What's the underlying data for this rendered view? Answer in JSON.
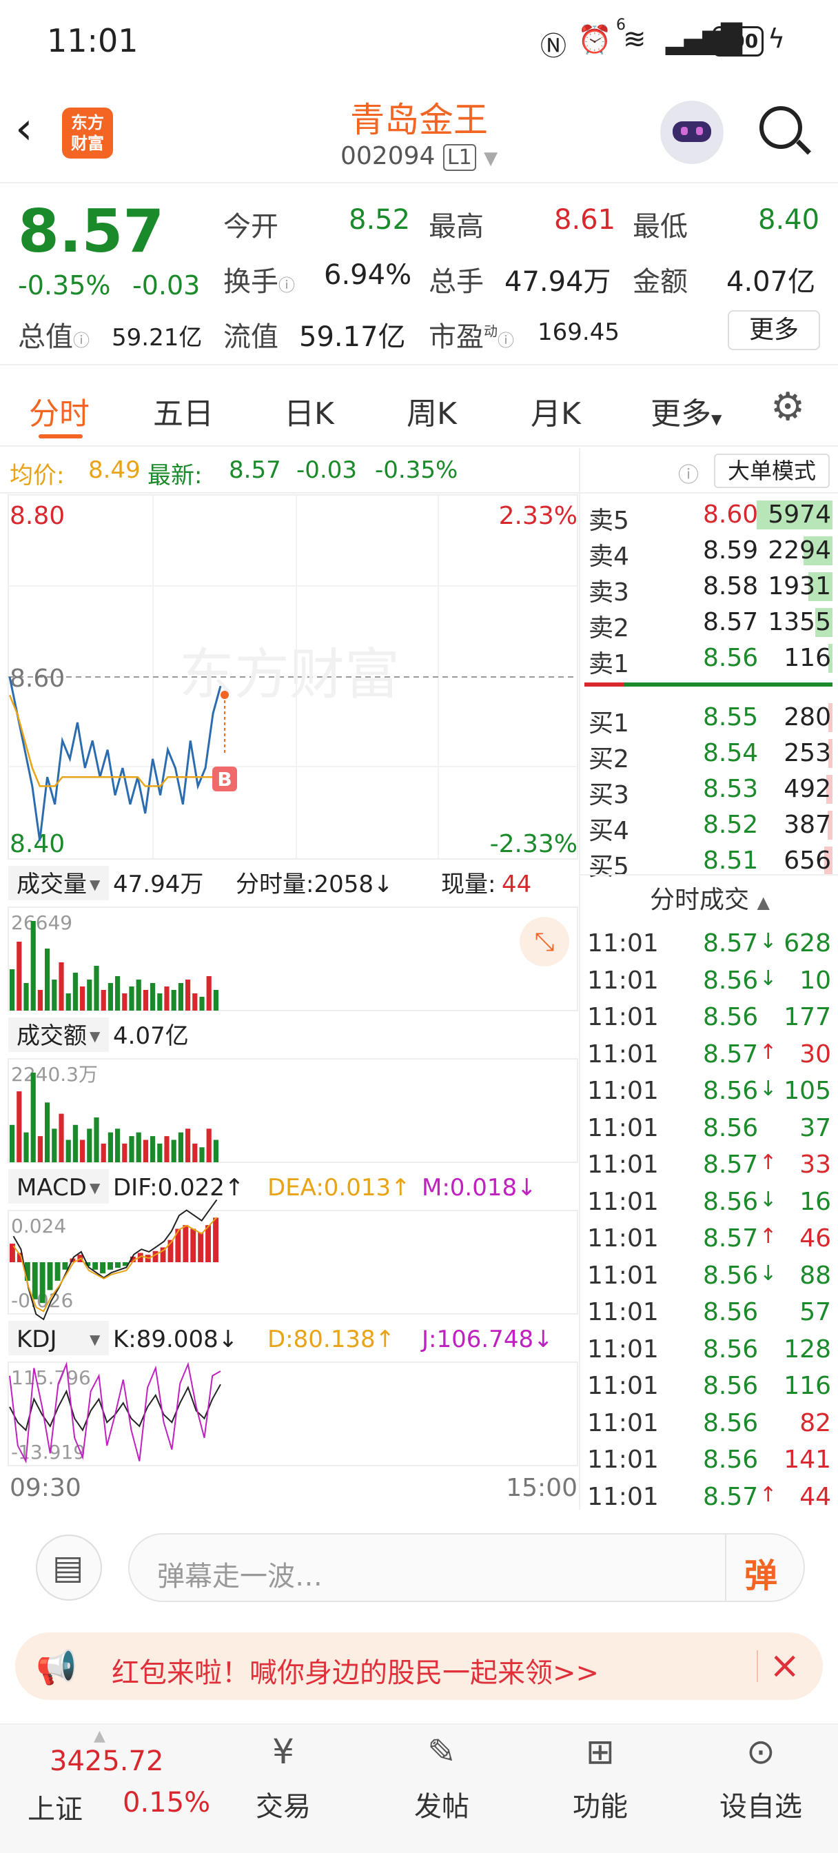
{
  "status_bar": {
    "time": "11:01",
    "battery": "100",
    "signal_label": "6"
  },
  "header": {
    "app_logo_line1": "东方",
    "app_logo_line2": "财富",
    "stock_name": "青岛金王",
    "stock_code": "002094",
    "level_badge": "L1"
  },
  "quote": {
    "price": "8.57",
    "change_pct": "-0.35%",
    "change_abs": "-0.03",
    "open_label": "今开",
    "open_value": "8.52",
    "high_label": "最高",
    "high_value": "8.61",
    "low_label": "最低",
    "low_value": "8.40",
    "turnover_label": "换手",
    "turnover_value": "6.94%",
    "volume_label": "总手",
    "volume_value": "47.94万",
    "amount_label": "金额",
    "amount_value": "4.07亿",
    "mktcap_label": "总值",
    "mktcap_value": "59.21亿",
    "float_label": "流值",
    "float_value": "59.17亿",
    "pe_label": "市盈",
    "pe_sup": "动",
    "pe_value": "169.45",
    "more_button": "更多"
  },
  "tabs": [
    {
      "label": "分时"
    },
    {
      "label": "五日"
    },
    {
      "label": "日K"
    },
    {
      "label": "周K"
    },
    {
      "label": "月K"
    },
    {
      "label": "更多"
    }
  ],
  "chart_header": {
    "avg_label": "均价:",
    "avg_value": "8.49",
    "latest_label": "最新:",
    "latest_value": "8.57",
    "latest_change": "-0.03",
    "latest_pct": "-0.35%",
    "big_order_mode": "大单模式"
  },
  "chart_data": [
    {
      "type": "line",
      "name_label": "分时",
      "y_high": "8.80",
      "y_mid": "8.60",
      "y_low": "8.40",
      "pct_high": "2.33%",
      "pct_low": "-2.33%",
      "watermark": "东方财富",
      "marker": "B",
      "series": [
        {
          "name": "价格",
          "color": "#2b6cb0",
          "values": [
            8.6,
            8.56,
            8.52,
            8.48,
            8.42,
            8.49,
            8.46,
            8.53,
            8.51,
            8.55,
            8.5,
            8.53,
            8.49,
            8.52,
            8.47,
            8.5,
            8.46,
            8.49,
            8.45,
            8.51,
            8.47,
            8.52,
            8.5,
            8.46,
            8.53,
            8.48,
            8.5,
            8.56,
            8.59
          ]
        },
        {
          "name": "均价",
          "color": "#e8a317",
          "values": [
            8.58,
            8.56,
            8.53,
            8.5,
            8.48,
            8.48,
            8.48,
            8.49,
            8.49,
            8.49,
            8.49,
            8.49,
            8.49,
            8.49,
            8.49,
            8.49,
            8.49,
            8.49,
            8.48,
            8.48,
            8.48,
            8.49,
            8.49,
            8.49,
            8.49,
            8.49,
            8.49,
            8.49,
            8.49
          ]
        }
      ],
      "ylim": [
        8.4,
        8.8
      ]
    },
    {
      "type": "bar",
      "name_label": "成交量",
      "total": "47.94万",
      "minute_vol_label": "分时量:2058↓",
      "current_vol_label": "现量:",
      "current_vol_value": "44",
      "y_max": "26649",
      "values": [
        12,
        20,
        8,
        26,
        6,
        18,
        9,
        14,
        5,
        11,
        7,
        9,
        13,
        6,
        8,
        10,
        5,
        7,
        9,
        6,
        8,
        5,
        7,
        6,
        8,
        9,
        5,
        4,
        10,
        6
      ]
    },
    {
      "type": "bar",
      "name_label": "成交额",
      "total": "4.07亿",
      "y_max": "2240.3万",
      "values": [
        10,
        19,
        8,
        24,
        7,
        16,
        9,
        13,
        6,
        10,
        6,
        9,
        12,
        5,
        8,
        9,
        5,
        7,
        8,
        6,
        7,
        5,
        7,
        6,
        8,
        9,
        5,
        4,
        9,
        6
      ]
    },
    {
      "type": "bar",
      "name_label": "MACD",
      "dif": "DIF:0.022↑",
      "dea": "DEA:0.013↑",
      "m": "M:0.018↓",
      "y_max": "0.024",
      "y_min": "-0.026",
      "values": [
        0.01,
        0.005,
        -0.01,
        -0.02,
        -0.022,
        -0.015,
        -0.01,
        -0.004,
        0.002,
        0.004,
        -0.002,
        -0.004,
        -0.006,
        -0.004,
        -0.003,
        -0.002,
        0.003,
        0.005,
        0.004,
        0.006,
        0.008,
        0.012,
        0.018,
        0.02,
        0.018,
        0.016,
        0.02,
        0.024
      ]
    },
    {
      "type": "line",
      "name_label": "KDJ",
      "k": "K:89.008↓",
      "d": "D:80.138↑",
      "j": "J:106.748↓",
      "y_max": "115.796",
      "y_min": "-13.919",
      "series": [
        {
          "name": "K",
          "values": [
            60,
            40,
            30,
            70,
            50,
            35,
            60,
            80,
            45,
            30,
            55,
            70,
            40,
            50,
            65,
            45,
            35,
            60,
            75,
            50,
            40,
            65,
            85,
            55,
            45,
            70,
            89
          ]
        },
        {
          "name": "J",
          "values": [
            100,
            10,
            -10,
            110,
            60,
            0,
            90,
            115,
            20,
            -5,
            80,
            100,
            10,
            50,
            95,
            30,
            -10,
            85,
            110,
            40,
            5,
            90,
            115,
            60,
            20,
            100,
            106
          ]
        }
      ]
    }
  ],
  "time_axis": {
    "start": "09:30",
    "end": "15:00"
  },
  "order_book": {
    "asks": [
      {
        "label": "卖5",
        "price": "8.60",
        "vol": "5974",
        "fill": 1.0
      },
      {
        "label": "卖4",
        "price": "8.59",
        "vol": "2294",
        "fill": 0.38
      },
      {
        "label": "卖3",
        "price": "8.58",
        "vol": "1931",
        "fill": 0.32
      },
      {
        "label": "卖2",
        "price": "8.57",
        "vol": "1355",
        "fill": 0.23
      },
      {
        "label": "卖1",
        "price": "8.56",
        "vol": "116",
        "fill": 0.02
      }
    ],
    "bids": [
      {
        "label": "买1",
        "price": "8.55",
        "vol": "280",
        "fill": 0.05
      },
      {
        "label": "买2",
        "price": "8.54",
        "vol": "253",
        "fill": 0.04
      },
      {
        "label": "买3",
        "price": "8.53",
        "vol": "492",
        "fill": 0.08
      },
      {
        "label": "买4",
        "price": "8.52",
        "vol": "387",
        "fill": 0.06
      },
      {
        "label": "买5",
        "price": "8.51",
        "vol": "656",
        "fill": 0.11
      }
    ],
    "ratio": 0.16
  },
  "ticks": {
    "title": "分时成交",
    "rows": [
      {
        "time": "11:01",
        "price": "8.57",
        "dir": "↓",
        "vol": "628",
        "c": "green",
        "vc": "green"
      },
      {
        "time": "11:01",
        "price": "8.56",
        "dir": "↓",
        "vol": "10",
        "c": "green",
        "vc": "green"
      },
      {
        "time": "11:01",
        "price": "8.56",
        "dir": "",
        "vol": "177",
        "c": "green",
        "vc": "green"
      },
      {
        "time": "11:01",
        "price": "8.57",
        "dir": "↑",
        "vol": "30",
        "c": "green",
        "vc": "red"
      },
      {
        "time": "11:01",
        "price": "8.56",
        "dir": "↓",
        "vol": "105",
        "c": "green",
        "vc": "green"
      },
      {
        "time": "11:01",
        "price": "8.56",
        "dir": "",
        "vol": "37",
        "c": "green",
        "vc": "green"
      },
      {
        "time": "11:01",
        "price": "8.57",
        "dir": "↑",
        "vol": "33",
        "c": "green",
        "vc": "red"
      },
      {
        "time": "11:01",
        "price": "8.56",
        "dir": "↓",
        "vol": "16",
        "c": "green",
        "vc": "green"
      },
      {
        "time": "11:01",
        "price": "8.57",
        "dir": "↑",
        "vol": "46",
        "c": "green",
        "vc": "red"
      },
      {
        "time": "11:01",
        "price": "8.56",
        "dir": "↓",
        "vol": "88",
        "c": "green",
        "vc": "green"
      },
      {
        "time": "11:01",
        "price": "8.56",
        "dir": "",
        "vol": "57",
        "c": "green",
        "vc": "green"
      },
      {
        "time": "11:01",
        "price": "8.56",
        "dir": "",
        "vol": "128",
        "c": "green",
        "vc": "green"
      },
      {
        "time": "11:01",
        "price": "8.56",
        "dir": "",
        "vol": "116",
        "c": "green",
        "vc": "green"
      },
      {
        "time": "11:01",
        "price": "8.56",
        "dir": "",
        "vol": "82",
        "c": "green",
        "vc": "red"
      },
      {
        "time": "11:01",
        "price": "8.56",
        "dir": "",
        "vol": "141",
        "c": "green",
        "vc": "red"
      },
      {
        "time": "11:01",
        "price": "8.57",
        "dir": "↑",
        "vol": "44",
        "c": "green",
        "vc": "red"
      }
    ]
  },
  "comment": {
    "placeholder": "弹幕走一波…",
    "send_label": "弹"
  },
  "banner": {
    "text": "红包来啦！喊你身边的股民一起来领>>"
  },
  "bottom_nav": {
    "index_value": "3425.72",
    "index_name": "上证",
    "index_pct": "0.15%",
    "items": [
      {
        "label": "交易"
      },
      {
        "label": "发帖"
      },
      {
        "label": "功能"
      },
      {
        "label": "设自选"
      }
    ]
  },
  "colors": {
    "red": "#d9272e",
    "green": "#1a8a2a",
    "orange": "#f26522",
    "gold": "#e8a317",
    "blue": "#2b6cb0",
    "purple": "#c020c0"
  }
}
